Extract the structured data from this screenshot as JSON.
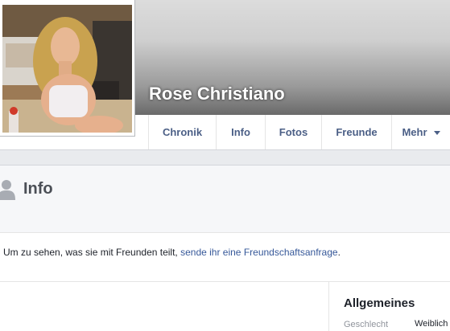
{
  "profile": {
    "name": "Rose Christiano"
  },
  "nav": {
    "tabs": [
      {
        "label": "Chronik"
      },
      {
        "label": "Info"
      },
      {
        "label": "Fotos"
      },
      {
        "label": "Freunde"
      },
      {
        "label": "Mehr"
      }
    ]
  },
  "info": {
    "title": "Info",
    "message_prefix": "Um zu sehen, was sie mit Freunden teilt, ",
    "message_link": "sende ihr eine Freundschaftsanfrage",
    "message_suffix": "."
  },
  "general": {
    "title": "Allgemeines",
    "fields": [
      {
        "label": "Geschlecht",
        "value": "Weiblich"
      }
    ]
  },
  "colors": {
    "link": "#365899",
    "tab_text": "#4b5f86",
    "background": "#e9ebee"
  }
}
